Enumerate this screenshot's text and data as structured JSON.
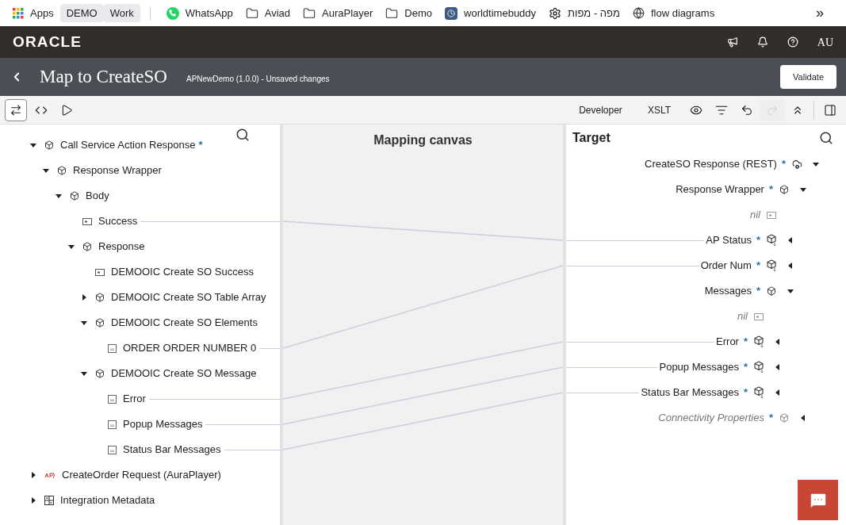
{
  "bookmarks": [
    {
      "label": "Apps",
      "kind": "apps"
    },
    {
      "label": "DEMO",
      "kind": "chip"
    },
    {
      "label": "Work",
      "kind": "chip"
    },
    {
      "label": "WhatsApp",
      "kind": "whatsapp"
    },
    {
      "label": "Aviad",
      "kind": "folder"
    },
    {
      "label": "AuraPlayer",
      "kind": "folder"
    },
    {
      "label": "Demo",
      "kind": "folder"
    },
    {
      "label": "worldtimebuddy",
      "kind": "clock"
    },
    {
      "label": "מפה - מפות",
      "kind": "gear"
    },
    {
      "label": "flow diagrams",
      "kind": "globe"
    }
  ],
  "bookmarks_overflow": "»",
  "header": {
    "brand": "ORACLE",
    "user": "AU"
  },
  "title_bar": {
    "title": "Map to CreateSO",
    "subtitle": "APNewDemo (1.0.0) - Unsaved changes",
    "action": "Validate"
  },
  "toolbar": {
    "left": [
      {
        "kind": "swap",
        "selected": true
      },
      {
        "kind": "code",
        "selected": false
      },
      {
        "kind": "play",
        "selected": false
      }
    ],
    "modes": [
      "Developer",
      "XSLT"
    ],
    "right": [
      {
        "kind": "eye",
        "disabled": false
      },
      {
        "kind": "filter",
        "disabled": false
      },
      {
        "kind": "undo",
        "disabled": false
      },
      {
        "kind": "redo",
        "disabled": true
      },
      {
        "kind": "collapse",
        "disabled": false
      },
      {
        "kind": "panel",
        "disabled": false
      }
    ]
  },
  "source": {
    "items": [
      {
        "label": "Call Service Action Response",
        "kind": "object",
        "required": true,
        "expanded": true,
        "children": [
          {
            "label": "Response Wrapper",
            "kind": "object",
            "expanded": true,
            "children": [
              {
                "label": "Body",
                "kind": "object",
                "expanded": true,
                "children": [
                  {
                    "label": "Success",
                    "kind": "boolean",
                    "mapped": true
                  },
                  {
                    "label": "Response",
                    "kind": "object",
                    "expanded": true,
                    "children": [
                      {
                        "label": "DEMOOIC Create SO Success",
                        "kind": "boolean"
                      },
                      {
                        "label": "DEMOOIC Create SO Table Array",
                        "kind": "object",
                        "expanded": false
                      },
                      {
                        "label": "DEMOOIC Create SO Elements",
                        "kind": "object",
                        "expanded": true,
                        "children": [
                          {
                            "label": "ORDER ORDER NUMBER 0",
                            "kind": "string",
                            "mapped": true
                          }
                        ]
                      },
                      {
                        "label": "DEMOOIC Create SO Message",
                        "kind": "object",
                        "expanded": true,
                        "children": [
                          {
                            "label": "Error",
                            "kind": "string",
                            "mapped": true
                          },
                          {
                            "label": "Popup Messages",
                            "kind": "string",
                            "mapped": true
                          },
                          {
                            "label": "Status Bar Messages",
                            "kind": "string",
                            "mapped": true
                          }
                        ]
                      }
                    ]
                  }
                ]
              }
            ]
          }
        ]
      },
      {
        "label": "CreateOrder Request (AuraPlayer)",
        "kind": "app",
        "expanded": false
      },
      {
        "label": "Integration Metadata",
        "kind": "metadata",
        "expanded": false
      }
    ]
  },
  "canvas": {
    "title": "Mapping canvas"
  },
  "target": {
    "title": "Target",
    "items": [
      {
        "label": "CreateSO Response (REST)",
        "kind": "rest",
        "required": true,
        "expanded": true,
        "children": [
          {
            "label": "Response Wrapper",
            "kind": "object",
            "required": true,
            "expanded": true,
            "children": [
              {
                "label": "nil",
                "kind": "boolean",
                "italic": true
              },
              {
                "label": "AP Status",
                "kind": "object",
                "required": true,
                "mapped": true,
                "expanded": false
              },
              {
                "label": "Order Num",
                "kind": "object",
                "required": true,
                "mapped": true,
                "expanded": false
              },
              {
                "label": "Messages",
                "kind": "object",
                "required": true,
                "expanded": true,
                "children": [
                  {
                    "label": "nil",
                    "kind": "boolean",
                    "italic": true
                  },
                  {
                    "label": "Error",
                    "kind": "object",
                    "required": true,
                    "mapped": true,
                    "expanded": false
                  },
                  {
                    "label": "Popup Messages",
                    "kind": "object",
                    "required": true,
                    "mapped": true,
                    "expanded": false
                  },
                  {
                    "label": "Status Bar Messages",
                    "kind": "object",
                    "required": true,
                    "mapped": true,
                    "expanded": false
                  }
                ]
              }
            ]
          },
          {
            "label": "Connectivity Properties",
            "kind": "object",
            "required": true,
            "italic": true,
            "expanded": false
          }
        ]
      }
    ]
  },
  "required_mark": "*"
}
